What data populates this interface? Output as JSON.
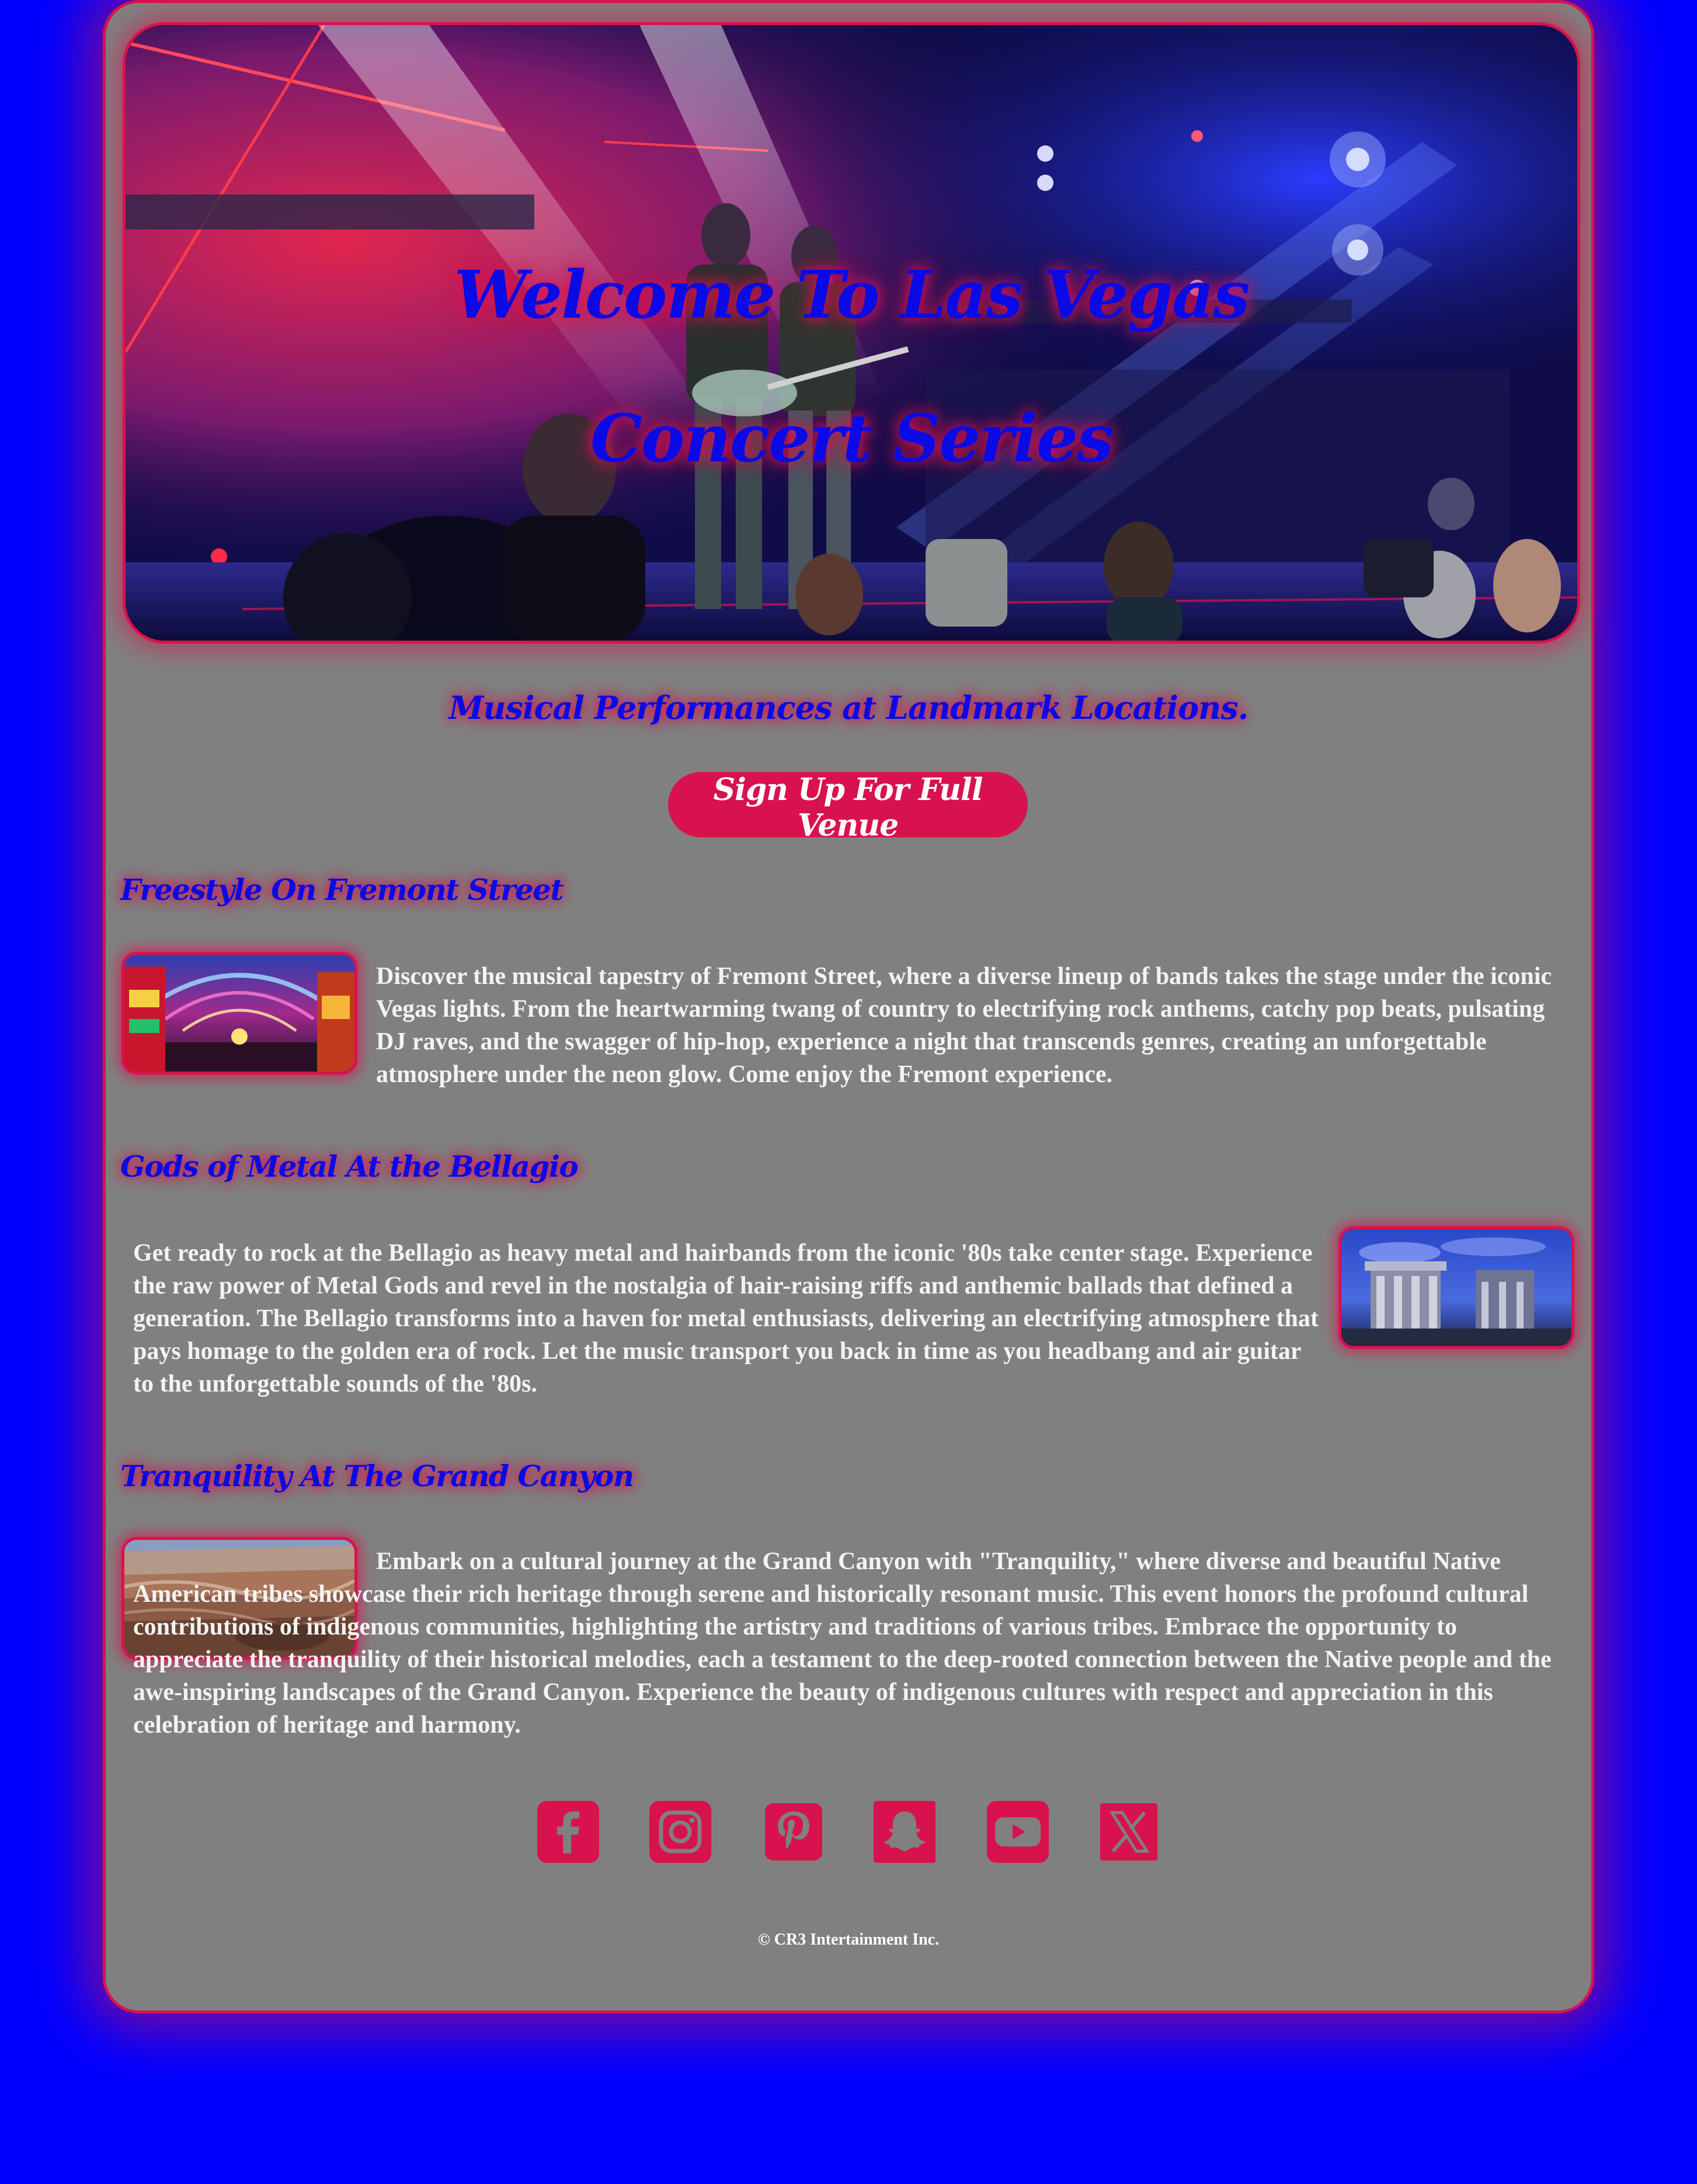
{
  "hero": {
    "title_line1": "Welcome To Las Vegas",
    "title_line2": "Concert Series"
  },
  "tagline": "Musical Performances at Landmark Locations.",
  "signup_button": "Sign Up For Full Venue",
  "sections": [
    {
      "title": "Freestyle On Fremont Street",
      "text": "Discover the musical tapestry of Fremont Street, where a diverse lineup of bands takes the stage under the iconic Vegas lights. From the heartwarming twang of country to electrifying rock anthems, catchy pop beats, pulsating DJ raves, and the swagger of hip-hop, experience a night that transcends genres, creating an unforgettable atmosphere under the neon glow. Come enjoy the Fremont experience.",
      "image": "fremont-street-canopy-photo"
    },
    {
      "title": "Gods of Metal At the Bellagio",
      "text": "Get ready to rock at the Bellagio as heavy metal and hairbands from the iconic '80s take center stage. Experience the raw power of Metal Gods and revel in the nostalgia of hair-raising riffs and anthemic ballads that defined a generation. The Bellagio transforms into a haven for metal enthusiasts, delivering an electrifying atmosphere that pays homage to the golden era of rock. Let the music transport you back in time as you headbang and air guitar to the unforgettable sounds of the '80s.",
      "image": "bellagio-photo"
    },
    {
      "title": "Tranquility At The Grand Canyon",
      "text": "Embark on a cultural journey at the Grand Canyon with \"Tranquility,\" where diverse and beautiful Native American tribes showcase their rich heritage through serene and historically resonant music. This event honors the profound cultural contributions of indigenous communities, highlighting the artistry and traditions of various tribes. Embrace the opportunity to appreciate the tranquility of their historical melodies, each a testament to the deep-rooted connection between the Native people and the awe-inspiring landscapes of the Grand Canyon. Experience the beauty of indigenous cultures with respect and appreciation in this celebration of heritage and harmony.",
      "image": "grand-canyon-photo"
    }
  ],
  "socials": [
    "facebook-icon",
    "instagram-icon",
    "pinterest-icon",
    "snapchat-icon",
    "youtube-icon",
    "x-icon"
  ],
  "copyright": "© CR3 Intertainment Inc.",
  "colors": {
    "background": "#0000ff",
    "card": "#808080",
    "accent": "#d8124e",
    "heading": "#0a0ae6",
    "body_text": "#f3f3f3"
  }
}
